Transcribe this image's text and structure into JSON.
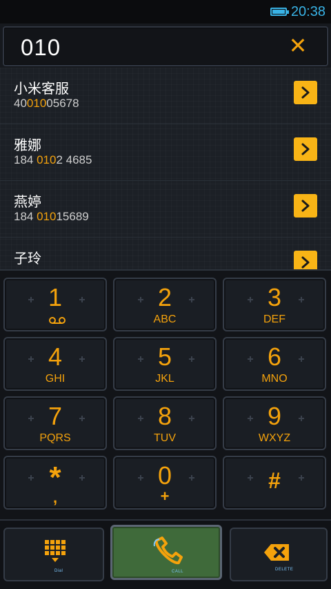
{
  "status_bar": {
    "time": "20:38"
  },
  "number_bar": {
    "value": "010"
  },
  "contacts": [
    {
      "name": "小米客服",
      "pre": "40",
      "match": "010",
      "post": "05678"
    },
    {
      "name": "雅娜",
      "pre": "184 ",
      "match": "010",
      "post": "2 4685"
    },
    {
      "name": "燕婷",
      "pre": "184 ",
      "match": "010",
      "post": "15689"
    },
    {
      "name": "子玲",
      "pre": "",
      "match": "",
      "post": ""
    }
  ],
  "keypad": [
    {
      "digit": "1",
      "letters": ""
    },
    {
      "digit": "2",
      "letters": "ABC"
    },
    {
      "digit": "3",
      "letters": "DEF"
    },
    {
      "digit": "4",
      "letters": "GHI"
    },
    {
      "digit": "5",
      "letters": "JKL"
    },
    {
      "digit": "6",
      "letters": "MNO"
    },
    {
      "digit": "7",
      "letters": "PQRS"
    },
    {
      "digit": "8",
      "letters": "TUV"
    },
    {
      "digit": "9",
      "letters": "WXYZ"
    },
    {
      "digit": "*",
      "letters": ","
    },
    {
      "digit": "0",
      "letters": "+"
    },
    {
      "digit": "#",
      "letters": ""
    }
  ],
  "bottom": {
    "dial_label": "Dial",
    "call_label": "CALL",
    "delete_label": "DELETE"
  },
  "colors": {
    "accent": "#f4a20c",
    "status": "#39b3e6",
    "call": "#3f6a3a"
  }
}
